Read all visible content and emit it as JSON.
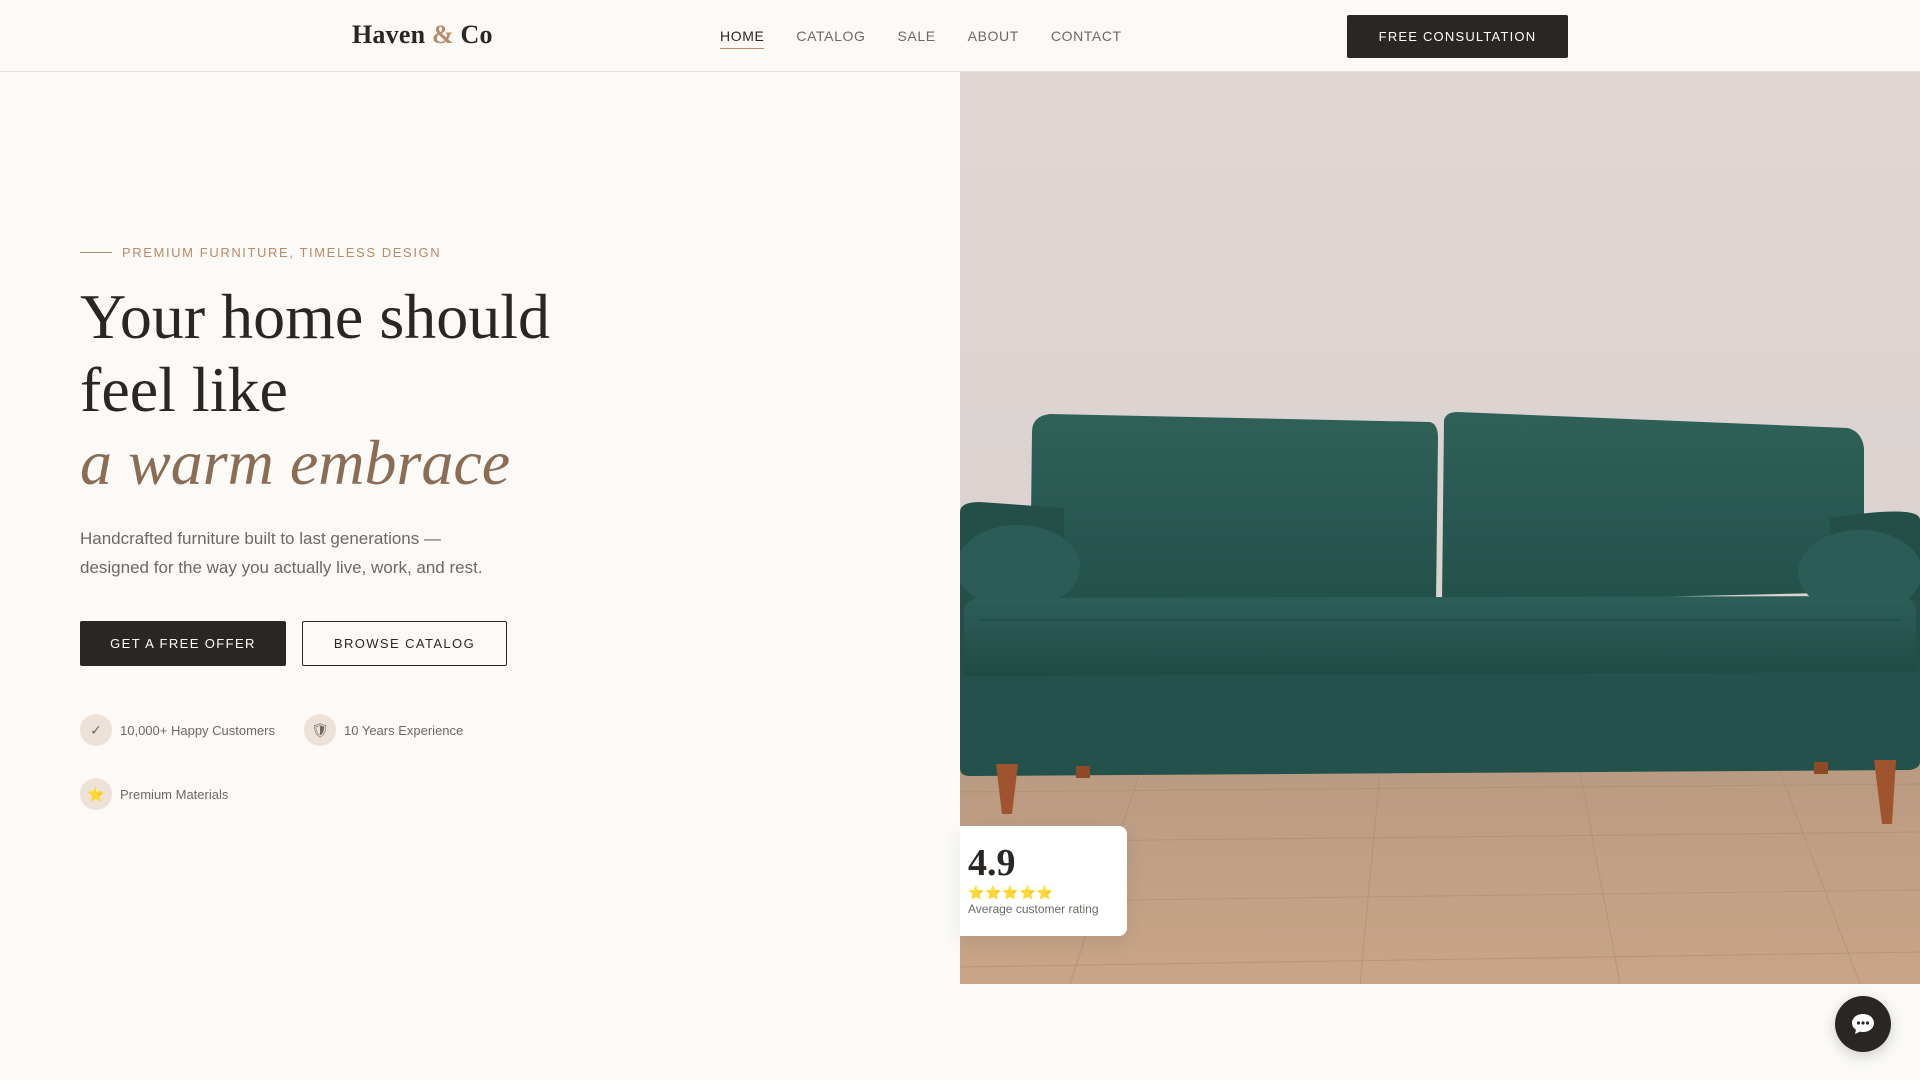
{
  "brand": {
    "name_part1": "Haven",
    "ampersand": "&",
    "name_part2": "Co"
  },
  "nav": {
    "items": [
      {
        "label": "HOME",
        "active": true
      },
      {
        "label": "CATALOG"
      },
      {
        "label": "SALE"
      },
      {
        "label": "ABOUT"
      },
      {
        "label": "CONTACT"
      }
    ],
    "cta_label": "FREE CONSULTATION"
  },
  "hero": {
    "eyebrow": "PREMIUM FURNITURE, TIMELESS DESIGN",
    "headline_line1": "Your home should",
    "headline_line2": "feel like",
    "headline_accent": "a warm embrace",
    "subtitle_line1": "Handcrafted furniture built to last generations —",
    "subtitle_line2": "designed for the way you actually live, work, and rest.",
    "primary_button": "GET A FREE OFFER",
    "secondary_button": "BROWSE CATALOG",
    "features": [
      {
        "icon": "check-icon",
        "glyph": "✓",
        "label": "10,000+ Happy Customers"
      },
      {
        "icon": "shield-icon",
        "glyph": "🛡",
        "label": "10 Years Experience"
      },
      {
        "icon": "star-icon",
        "glyph": "⭐",
        "label": "Premium Materials"
      }
    ]
  },
  "rating": {
    "score": "4.9",
    "stars": "⭐⭐⭐⭐⭐",
    "caption": "Average customer rating"
  },
  "colors": {
    "background": "#fbfaf7",
    "dark": "#2a2624",
    "accent": "#b98a68",
    "accent_serif": "#8a6d54",
    "sofa": "#2e5b55"
  }
}
